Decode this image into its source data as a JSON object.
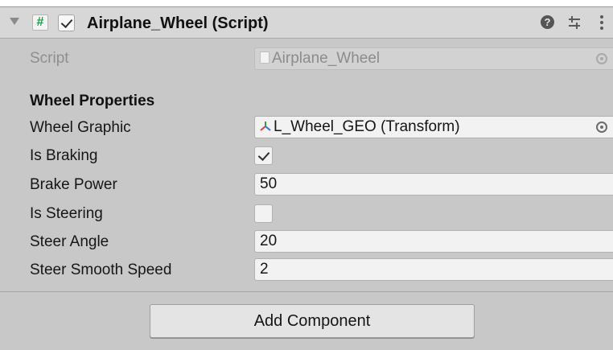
{
  "component": {
    "title": "Airplane_Wheel (Script)",
    "enabled": true,
    "script_icon_glyph": "#",
    "icons": [
      "foldout-arrow-icon",
      "script-icon",
      "help-icon",
      "presets-icon",
      "menu-icon"
    ],
    "accent_color": "#1e9b4e"
  },
  "script_row": {
    "label": "Script",
    "value": "Airplane_Wheel"
  },
  "section": {
    "title": "Wheel Properties"
  },
  "properties": {
    "wheel_graphic": {
      "label": "Wheel Graphic",
      "value": "L_Wheel_GEO (Transform)"
    },
    "is_braking": {
      "label": "Is Braking",
      "checked": true
    },
    "brake_power": {
      "label": "Brake Power",
      "value": "50"
    },
    "is_steering": {
      "label": "Is Steering",
      "checked": false
    },
    "steer_angle": {
      "label": "Steer Angle",
      "value": "20"
    },
    "steer_smooth_speed": {
      "label": "Steer Smooth Speed",
      "value": "2"
    }
  },
  "footer": {
    "add_component_label": "Add Component"
  },
  "help_glyph": "?"
}
